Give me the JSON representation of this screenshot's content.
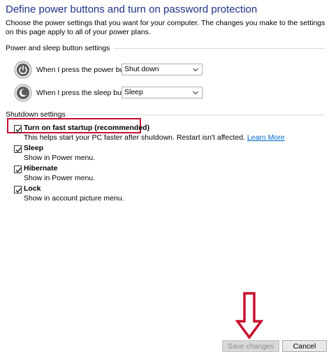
{
  "header": {
    "title": "Define power buttons and turn on password protection",
    "description": "Choose the power settings that you want for your computer. The changes you make to the settings on this page apply to all of your power plans."
  },
  "power_sleep": {
    "heading": "Power and sleep button settings",
    "power_button": {
      "label": "When I press the power button:",
      "value": "Shut down",
      "icon": "power-icon"
    },
    "sleep_button": {
      "label": "When I press the sleep button:",
      "value": "Sleep",
      "icon": "moon-icon"
    }
  },
  "shutdown": {
    "heading": "Shutdown settings",
    "fast_startup": {
      "label": "Turn on fast startup (recommended)",
      "desc": "This helps start your PC faster after shutdown. Restart isn't affected.",
      "link": "Learn More",
      "checked": true
    },
    "sleep": {
      "label": "Sleep",
      "desc": "Show in Power menu.",
      "checked": true
    },
    "hibernate": {
      "label": "Hibernate",
      "desc": "Show in Power menu.",
      "checked": true
    },
    "lock": {
      "label": "Lock",
      "desc": "Show in account picture menu.",
      "checked": true
    }
  },
  "footer": {
    "save_label": "Save changes",
    "cancel_label": "Cancel"
  },
  "colors": {
    "title": "#1e3287",
    "link": "#0066cc",
    "highlight": "#c8102e",
    "arrow": "#c8102e"
  }
}
